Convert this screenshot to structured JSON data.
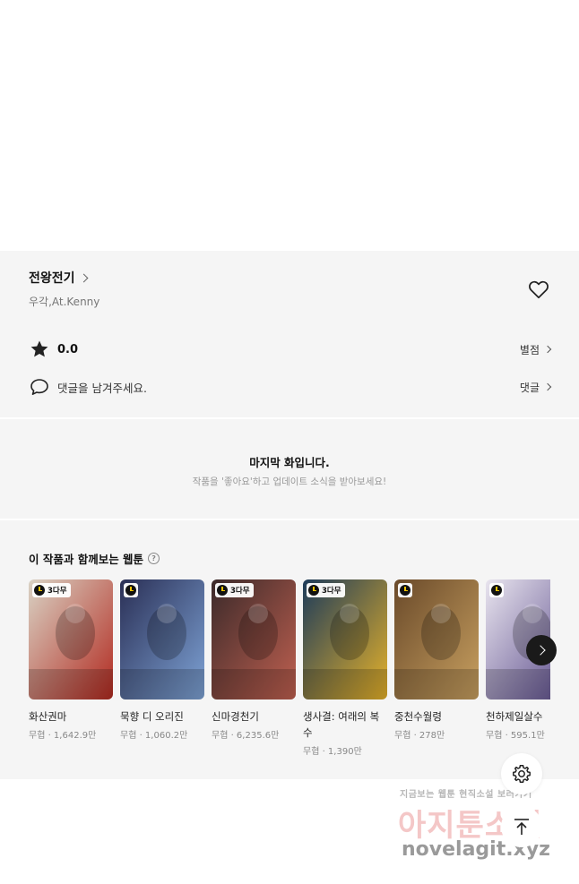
{
  "work": {
    "title": "전왕전기",
    "authors": "우각,At.Kenny"
  },
  "rating": {
    "value": "0.0",
    "link_label": "별점"
  },
  "comments": {
    "prompt": "댓글을 남겨주세요.",
    "link_label": "댓글"
  },
  "last_episode": {
    "title": "마지막 화입니다.",
    "subtitle": "작품을 '좋아요'하고 업데이트 소식을 받아보세요!"
  },
  "recommendations": {
    "heading": "이 작품과 함께보는 웹툰",
    "help_glyph": "?",
    "items": [
      {
        "title": "화산권마",
        "meta": "무협 · 1,642.9만",
        "badge": "3다무",
        "colors": [
          "#d9d2c4",
          "#b22a20"
        ]
      },
      {
        "title": "묵향 디 오리진",
        "meta": "무협 · 1,060.2만",
        "badge": "",
        "colors": [
          "#2a2f55",
          "#7ea3d6"
        ]
      },
      {
        "title": "신마경천기",
        "meta": "무협 · 6,235.6만",
        "badge": "3다무",
        "colors": [
          "#3b2a2a",
          "#c06050"
        ]
      },
      {
        "title": "생사결: 여래의 복수",
        "meta": "무협 · 1,390만",
        "badge": "3다무",
        "colors": [
          "#1d3b5a",
          "#e6b22a"
        ]
      },
      {
        "title": "중천수월령",
        "meta": "무협 · 278만",
        "badge": "",
        "colors": [
          "#6a4a2a",
          "#c8a060"
        ]
      },
      {
        "title": "천하제일살수",
        "meta": "무협 · 595.1만",
        "badge": "",
        "colors": [
          "#e8e4ee",
          "#5a4a8a"
        ]
      }
    ]
  },
  "watermark": {
    "line1": "지금보는 웹툰 현직소설 보러가기",
    "line2": "아지툰소설",
    "line3": "novelagit.xyz"
  },
  "icons": {
    "heart": "heart-icon",
    "star": "star-icon",
    "comment": "comment-icon",
    "settings": "gear-icon",
    "scroll_top": "arrow-up-icon",
    "next": "chevron-right-icon"
  }
}
